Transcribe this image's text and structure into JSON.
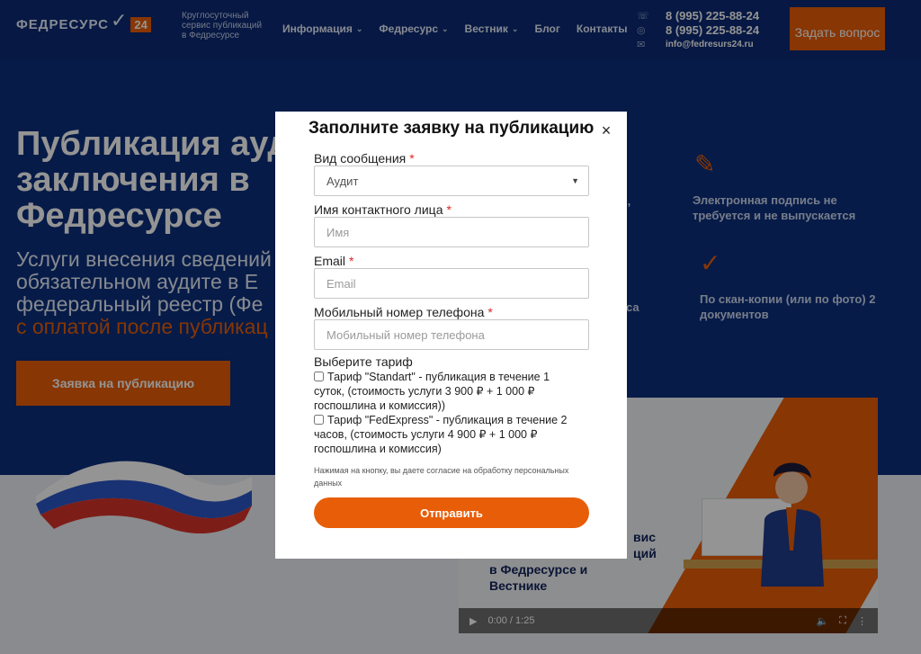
{
  "header": {
    "logo_text": "ФЕДРЕСУРС",
    "logo_badge": "24",
    "tagline": "Круглосуточный сервис публикаций в Федресурсе",
    "nav": [
      {
        "label": "Информация",
        "has_dropdown": true
      },
      {
        "label": "Федресурс",
        "has_dropdown": true
      },
      {
        "label": "Вестник",
        "has_dropdown": true
      },
      {
        "label": "Блог",
        "has_dropdown": false
      },
      {
        "label": "Контакты",
        "has_dropdown": false
      }
    ],
    "phone_1": "8 (995) 225-88-24",
    "phone_2": "8 (995) 225-88-24",
    "email": "info@fedresurs24.ru",
    "ask_button": "Задать вопрос"
  },
  "hero": {
    "title_line1": "Публикация аудит",
    "title_line2": "заключения в",
    "title_line3": "Федресурсе",
    "subtitle_line1": "Услуги внесения сведений",
    "subtitle_line2": "обязательном аудите в Е",
    "subtitle_line3": "федеральный реестр (Фе",
    "subtitle_accent": "с оплатой после публикац",
    "cta": "Заявка на публикацию",
    "feature_1": "Электронная подпись не требуется и не выпускается",
    "feature_2": "По скан-копии (или по фото) 2 документов",
    "fragment_1": "я,",
    "fragment_2": "са"
  },
  "video": {
    "caption_line1": "вис",
    "caption_line2": "ций",
    "caption_line3": "в Федресурсе и",
    "caption_line4": "Вестнике",
    "time": "0:00 / 1:25"
  },
  "modal": {
    "title": "Заполните заявку на публикацию",
    "close_glyph": "×",
    "message_type_label": "Вид сообщения",
    "message_type_value": "Аудит",
    "name_label": "Имя контактного лица",
    "name_placeholder": "Имя",
    "email_label": "Email",
    "email_placeholder": "Email",
    "phone_label": "Мобильный номер телефона",
    "phone_placeholder": "Мобильный номер телефона",
    "required_mark": "*",
    "tariff_label": "Выберите тариф",
    "tariff_standart": "Тариф \"Standart\" - публикация в течение 1 суток, (стоимость услуги 3 900 ₽ + 1 000 ₽ госпошлина и комиссия))",
    "tariff_fedexpress": "Тариф \"FedExpress\" - публикация в течение 2 часов, (стоимость услуги 4 900 ₽ + 1 000 ₽ госпошлина и комиссия)",
    "consent": "Нажимая на кнопку, вы даете согласие на обработку персональных данных",
    "submit": "Отправить"
  },
  "colors": {
    "accent": "#e85d07",
    "header_bg": "#0b2a74",
    "hero_bg": "#0c2f7d"
  }
}
